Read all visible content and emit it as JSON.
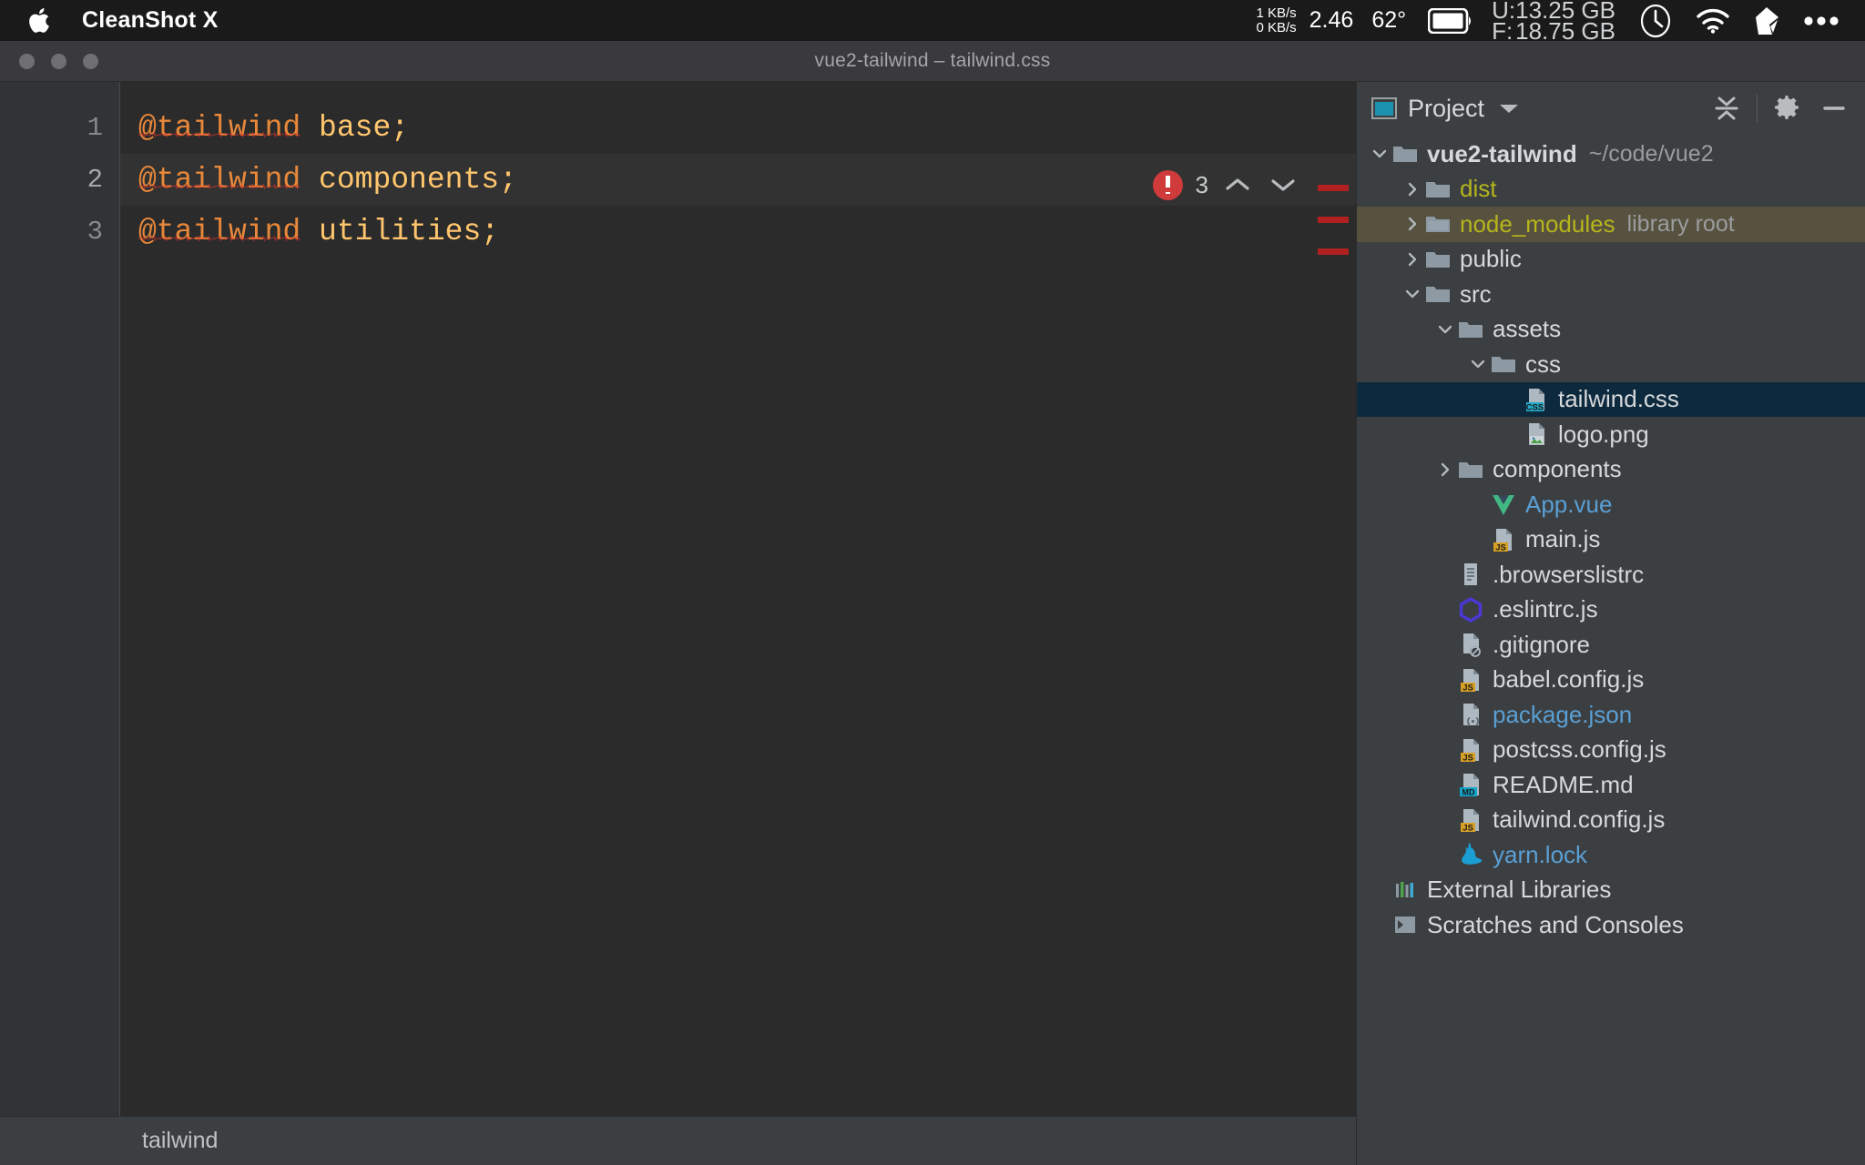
{
  "menubar": {
    "apple_icon": "apple-logo-icon",
    "app_name": "CleanShot X",
    "net_up": "1 KB/s",
    "net_down": "0 KB/s",
    "cpu_load": "2.46",
    "temperature": "62°",
    "battery_icon": "battery-icon",
    "disk_used_key": "U:",
    "disk_used_value": "13.25 GB",
    "disk_free_key": "F:",
    "disk_free_value": "18.75 GB",
    "clock_icon": "clock-icon",
    "wifi_icon": "wifi-icon",
    "dropbox_icon": "dropbox-icon",
    "more_icon": "ellipsis-icon"
  },
  "window": {
    "title": "vue2-tailwind – tailwind.css",
    "traffic_lights": [
      "close",
      "minimize",
      "zoom"
    ]
  },
  "editor": {
    "lines": [
      {
        "num": "1",
        "keyword": "@tailwind",
        "value": " base;",
        "current": false
      },
      {
        "num": "2",
        "keyword": "@tailwind",
        "value": " components;",
        "current": true
      },
      {
        "num": "3",
        "keyword": "@tailwind",
        "value": " utilities;",
        "current": false
      }
    ],
    "error_count": "3",
    "error_icon": "error-circle-icon",
    "prev_icon": "chevron-up-icon",
    "next_icon": "chevron-down-icon",
    "stripes": [
      163,
      198,
      233
    ],
    "breadcrumb": "tailwind"
  },
  "project": {
    "header": {
      "window_icon": "project-window-icon",
      "title": "Project",
      "dropdown_icon": "chevron-down-icon",
      "collapse_all_icon": "collapse-all-icon",
      "settings_icon": "gear-icon",
      "hide_icon": "minimize-icon"
    },
    "tree": [
      {
        "name": "vue2-tailwind",
        "sub": "~/code/vue2",
        "indent": 0,
        "arrow": "down",
        "icon": "folder-icon",
        "color": "white",
        "bold": true
      },
      {
        "name": "dist",
        "sub": "",
        "indent": 1,
        "arrow": "right",
        "icon": "folder-icon",
        "color": "yellow",
        "bold": false
      },
      {
        "name": "node_modules",
        "sub": "library root",
        "indent": 1,
        "arrow": "right",
        "icon": "folder-lib-icon",
        "color": "yellow",
        "bold": false,
        "highlight": "lib"
      },
      {
        "name": "public",
        "sub": "",
        "indent": 1,
        "arrow": "right",
        "icon": "folder-icon",
        "color": "white",
        "bold": false
      },
      {
        "name": "src",
        "sub": "",
        "indent": 1,
        "arrow": "down",
        "icon": "folder-icon",
        "color": "white",
        "bold": false
      },
      {
        "name": "assets",
        "sub": "",
        "indent": 2,
        "arrow": "down",
        "icon": "folder-icon",
        "color": "white",
        "bold": false
      },
      {
        "name": "css",
        "sub": "",
        "indent": 3,
        "arrow": "down",
        "icon": "folder-icon",
        "color": "white",
        "bold": false
      },
      {
        "name": "tailwind.css",
        "sub": "",
        "indent": 4,
        "arrow": "none",
        "icon": "css-file-icon",
        "color": "white",
        "bold": false,
        "highlight": "selected"
      },
      {
        "name": "logo.png",
        "sub": "",
        "indent": 4,
        "arrow": "none",
        "icon": "image-file-icon",
        "color": "white",
        "bold": false
      },
      {
        "name": "components",
        "sub": "",
        "indent": 2,
        "arrow": "right",
        "icon": "folder-icon",
        "color": "white",
        "bold": false
      },
      {
        "name": "App.vue",
        "sub": "",
        "indent": 3,
        "arrow": "none",
        "icon": "vue-file-icon",
        "color": "blue",
        "bold": false
      },
      {
        "name": "main.js",
        "sub": "",
        "indent": 3,
        "arrow": "none",
        "icon": "js-file-icon",
        "color": "white",
        "bold": false
      },
      {
        "name": ".browserslistrc",
        "sub": "",
        "indent": 2,
        "arrow": "none",
        "icon": "text-file-icon",
        "color": "white",
        "bold": false
      },
      {
        "name": ".eslintrc.js",
        "sub": "",
        "indent": 2,
        "arrow": "none",
        "icon": "eslint-file-icon",
        "color": "white",
        "bold": false
      },
      {
        "name": ".gitignore",
        "sub": "",
        "indent": 2,
        "arrow": "none",
        "icon": "gitignore-file-icon",
        "color": "white",
        "bold": false
      },
      {
        "name": "babel.config.js",
        "sub": "",
        "indent": 2,
        "arrow": "none",
        "icon": "js-file-icon",
        "color": "white",
        "bold": false
      },
      {
        "name": "package.json",
        "sub": "",
        "indent": 2,
        "arrow": "none",
        "icon": "json-file-icon",
        "color": "blue",
        "bold": false
      },
      {
        "name": "postcss.config.js",
        "sub": "",
        "indent": 2,
        "arrow": "none",
        "icon": "js-file-icon",
        "color": "white",
        "bold": false
      },
      {
        "name": "README.md",
        "sub": "",
        "indent": 2,
        "arrow": "none",
        "icon": "md-file-icon",
        "color": "white",
        "bold": false
      },
      {
        "name": "tailwind.config.js",
        "sub": "",
        "indent": 2,
        "arrow": "none",
        "icon": "js-file-icon",
        "color": "white",
        "bold": false
      },
      {
        "name": "yarn.lock",
        "sub": "",
        "indent": 2,
        "arrow": "none",
        "icon": "yarn-file-icon",
        "color": "blue",
        "bold": false
      },
      {
        "name": "External Libraries",
        "sub": "",
        "indent": 0,
        "arrow": "none",
        "icon": "external-libraries-icon",
        "color": "white",
        "bold": false
      },
      {
        "name": "Scratches and Consoles",
        "sub": "",
        "indent": 0,
        "arrow": "none",
        "icon": "scratches-icon",
        "color": "white",
        "bold": false
      }
    ]
  },
  "annotation": {
    "shape": "rectangle",
    "color": "#fb5c5c",
    "target": "tailwind.css"
  },
  "colors": {
    "editor_bg": "#2b2b2b",
    "panel_bg": "#3c3f41",
    "gutter_bg": "#313335",
    "selection_bg": "#0d293e",
    "library_bg": "#57513f",
    "keyword_orange": "#e8883a",
    "value_gold": "#ffc66d",
    "error_red": "#cf3b3b",
    "annotation_red": "#fb5c5c",
    "excluded_yellow": "#b5b51c",
    "vcs_blue": "#5a9fd4"
  }
}
